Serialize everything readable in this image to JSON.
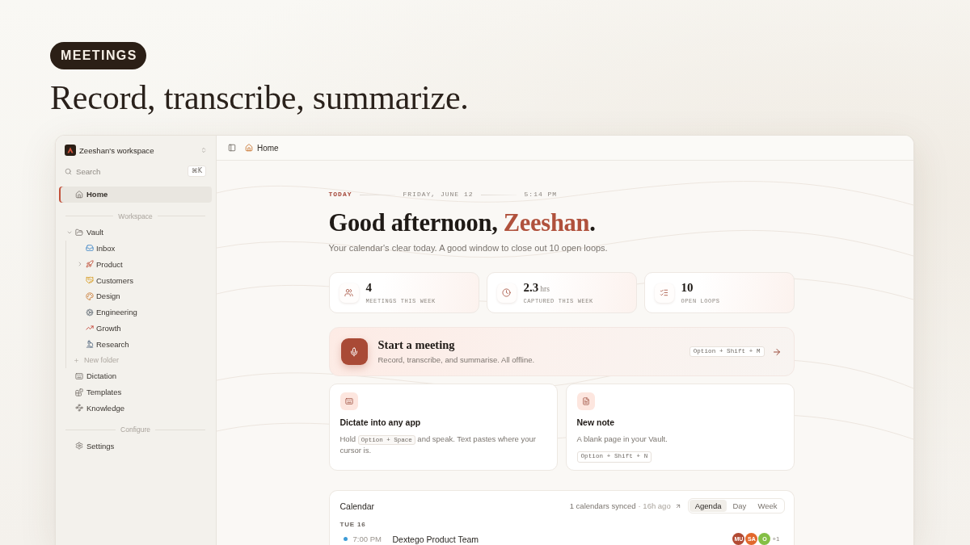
{
  "badge": "MEETINGS",
  "headline": "Record, transcribe, summarize.",
  "sidebar": {
    "workspace": "Zeeshan's workspace",
    "search": {
      "placeholder": "Search",
      "shortcut": "⌘K"
    },
    "nav": [
      {
        "kind": "link",
        "label": "Home",
        "selected": true
      },
      {
        "kind": "heading",
        "label": "Workspace"
      },
      {
        "kind": "folder",
        "label": "Vault",
        "selected": false,
        "expanded": true,
        "children": [
          {
            "label": "Inbox",
            "selected": false
          },
          {
            "label": "Product",
            "selected": false,
            "expanded": false
          },
          {
            "label": "Customers",
            "selected": false
          },
          {
            "label": "Design",
            "selected": false
          },
          {
            "label": "Engineering",
            "selected": false
          },
          {
            "label": "Growth",
            "selected": false
          },
          {
            "label": "Research",
            "selected": false
          }
        ],
        "new_folder": "New folder"
      },
      {
        "kind": "link",
        "label": "Dictation",
        "selected": false
      },
      {
        "kind": "link",
        "label": "Templates",
        "selected": false
      },
      {
        "kind": "link",
        "label": "Knowledge",
        "selected": false
      },
      {
        "kind": "heading",
        "label": "Configure"
      },
      {
        "kind": "link",
        "label": "Settings",
        "selected": false
      }
    ]
  },
  "topbar": {
    "page": "Home"
  },
  "today": {
    "label": "TODAY",
    "date": "FRIDAY, JUNE 12",
    "time": "5:14 PM"
  },
  "greeting": {
    "before": "Good afternoon, ",
    "name": "Zeeshan",
    "after": "."
  },
  "summary": "Your calendar's clear today. A good window to close out 10 open loops.",
  "stats": [
    {
      "value": "4",
      "label": "MEETINGS THIS WEEK"
    },
    {
      "value": "2.3",
      "unit": "hrs",
      "label": "CAPTURED THIS WEEK"
    },
    {
      "value": "10",
      "label": "OPEN LOOPS"
    }
  ],
  "start_meeting": {
    "title": "Start a meeting",
    "subtitle": "Record, transcribe, and summarise. All offline.",
    "shortcut": "Option + Shift + M"
  },
  "actions": [
    {
      "kind": "inline",
      "title": "Dictate into any app",
      "text": "Hold ",
      "shortcut": "Option + Space",
      "text_after": " and speak. Text pastes where your cursor is."
    },
    {
      "kind": "stacked",
      "title": "New note",
      "text": "A blank page in your Vault.",
      "shortcut": "Option + Shift + N"
    }
  ],
  "calendar": {
    "title": "Calendar",
    "synced": "1 calendars synced",
    "updated": "· 16h ago",
    "views": [
      {
        "label": "Agenda",
        "selected": true
      },
      {
        "label": "Day",
        "selected": false
      },
      {
        "label": "Week",
        "selected": false
      }
    ],
    "days": [
      {
        "label": "TUE 16",
        "events": [
          {
            "time": "7:00 PM",
            "title": "Dextego Product Team",
            "color": "#3d9bd6",
            "attendees": [
              {
                "initials": "MU",
                "color": "#b24a33"
              },
              {
                "initials": "SA",
                "color": "#e2682c"
              },
              {
                "initials": "O",
                "color": "#84bf45"
              }
            ],
            "more": "+1"
          }
        ]
      }
    ]
  }
}
